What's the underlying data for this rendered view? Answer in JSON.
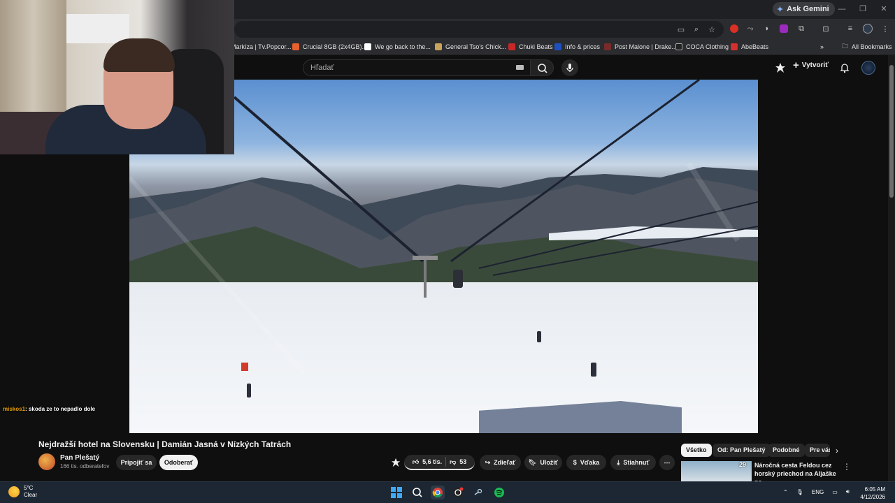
{
  "browser": {
    "gemini_label": "Ask Gemini",
    "bookmarks": [
      {
        "label": "Markíza | Tv.Popcor...",
        "color": "#3a3a3a"
      },
      {
        "label": "Crucial 8GB (2x4GB)...",
        "color": "#e8602c"
      },
      {
        "label": "We go back to the...",
        "color": "#ffffff"
      },
      {
        "label": "General Tso's Chick...",
        "color": "#c8a45a"
      },
      {
        "label": "Chuki Beats",
        "color": "#c62828"
      },
      {
        "label": "Info & prices",
        "color": "#1e4fbf"
      },
      {
        "label": "Post Malone | Drake...",
        "color": "#7a2a2a"
      },
      {
        "label": "COCA Clothing",
        "color": "#222222"
      },
      {
        "label": "AbeBeats",
        "color": "#d32f2f"
      }
    ],
    "all_bookmarks": "All Bookmarks"
  },
  "youtube": {
    "search_placeholder": "Hľadať",
    "create_label": "Vytvoriť"
  },
  "chat": {
    "user": "miskos1",
    "message": ": skoda ze to nepadlo dole"
  },
  "video": {
    "title": "Nejdražší hotel na Slovensku | Damián Jasná v Nízkých Tatrách",
    "channel_name": "Pan Plešatý",
    "subscribers": "166 tis. odberateľov",
    "join_label": "Pripojiť sa",
    "unsubscribe_label": "Odoberať",
    "likes": "5,6 tis.",
    "dislikes": "53",
    "share_label": "Zdieľať",
    "save_label": "Uložiť",
    "thanks_label": "Vďaka",
    "download_label": "Stiahnuť"
  },
  "chips": [
    "Všetko",
    "Od: Pan Plešatý",
    "Podobné",
    "Pre vás"
  ],
  "recommendation": {
    "badge": "29",
    "title": "Náročná cesta Feldou cez horský priechod na Aljaške na ..."
  },
  "taskbar": {
    "temperature": "5°C",
    "condition": "Clear",
    "language": "ENG",
    "time": "6:05 AM",
    "date": "4/12/2026"
  }
}
